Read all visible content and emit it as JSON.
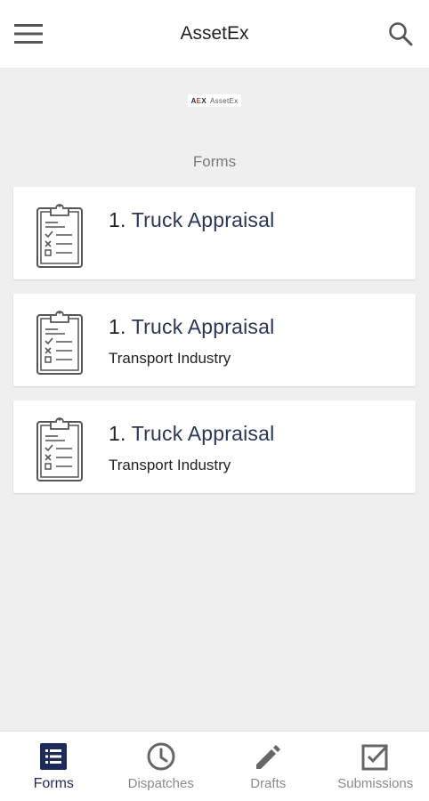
{
  "header": {
    "title": "AssetEx",
    "menu_icon": "hamburger-menu-icon",
    "search_icon": "search-icon"
  },
  "logo": {
    "mark_prefix": "A",
    "mark_accent": "E",
    "mark_suffix": "X",
    "word": "AssetEx"
  },
  "section": {
    "label": "Forms"
  },
  "forms": [
    {
      "number": "1.",
      "title": "Truck Appraisal",
      "subtitle": "",
      "icon": "clipboard-checklist-icon"
    },
    {
      "number": "1.",
      "title": "Truck Appraisal",
      "subtitle": "Transport Industry",
      "icon": "clipboard-checklist-icon"
    },
    {
      "number": "1.",
      "title": "Truck Appraisal",
      "subtitle": "Transport Industry",
      "icon": "clipboard-checklist-icon"
    }
  ],
  "bottom_nav": {
    "items": [
      {
        "label": "Forms",
        "icon": "list-icon",
        "active": true
      },
      {
        "label": "Dispatches",
        "icon": "clock-icon",
        "active": false
      },
      {
        "label": "Drafts",
        "icon": "pencil-icon",
        "active": false
      },
      {
        "label": "Submissions",
        "icon": "checkbox-icon",
        "active": false
      }
    ]
  },
  "colors": {
    "accent": "#1e2a5a",
    "background": "#efefef",
    "card": "#ffffff",
    "inactive": "#8a8a8a"
  }
}
